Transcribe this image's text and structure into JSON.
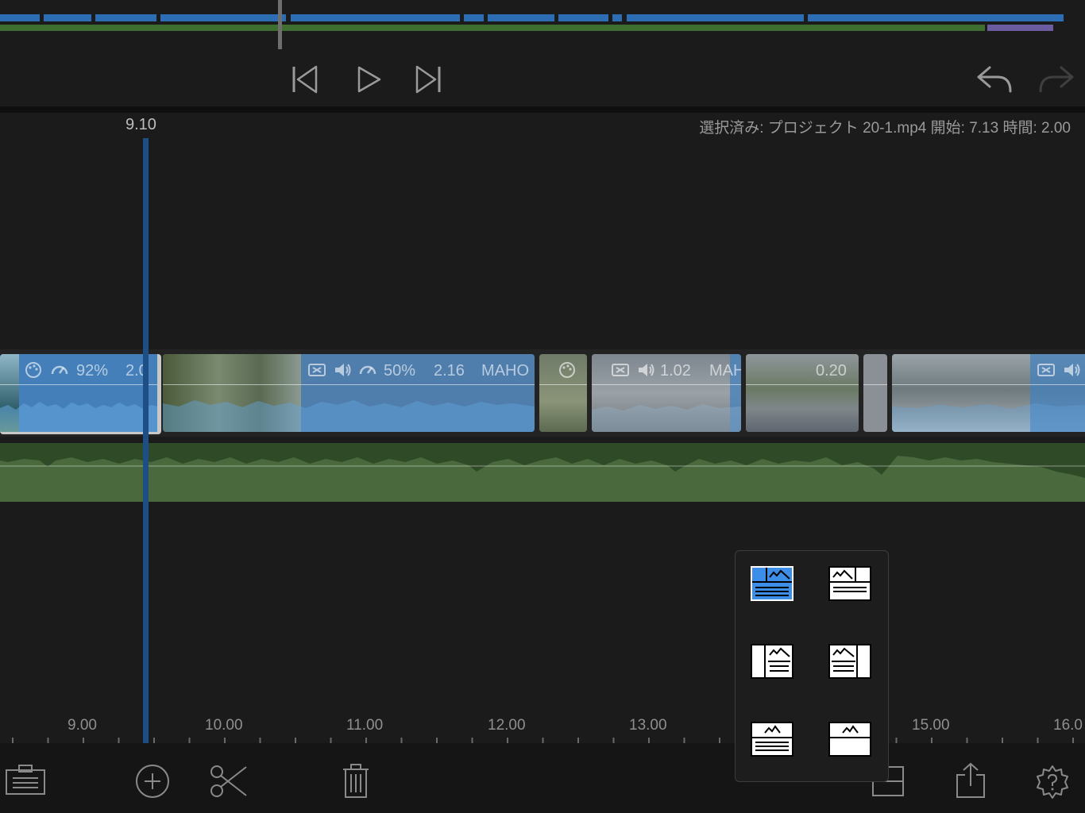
{
  "timeline": {
    "playhead_time": "9.10",
    "selection_info": "選択済み: プロジェクト 20-1.mp4 開始: 7.13 時間: 2.00"
  },
  "clips": [
    {
      "labels": [
        "92%",
        "2.0"
      ]
    },
    {
      "labels": [
        "50%",
        "2.16",
        "MAHO"
      ]
    },
    {
      "labels": []
    },
    {
      "labels": [
        "1.02",
        "MAH"
      ]
    },
    {
      "labels": [
        "0.20"
      ]
    },
    {
      "labels": []
    },
    {
      "labels": []
    }
  ],
  "ruler": {
    "labels": [
      "9.00",
      "10.00",
      "11.00",
      "12.00",
      "13.00",
      "15.00",
      "16.0"
    ]
  },
  "icons": {
    "transport": [
      "skip-to-start-icon",
      "play-icon",
      "skip-to-end-icon",
      "undo-icon",
      "redo-icon"
    ],
    "toolbar": [
      "clip-list-icon",
      "add-icon",
      "scissors-icon",
      "trash-icon",
      "layout-icon",
      "share-icon",
      "settings-help-icon"
    ]
  },
  "layout_popover": {
    "selected_index": 0,
    "option_count": 6
  },
  "colors": {
    "background": "#1b1b1b",
    "video_track_blue": "#2d6db3",
    "audio_track_green": "#4a6a3e",
    "selected_layout": "#3d8ee8"
  }
}
